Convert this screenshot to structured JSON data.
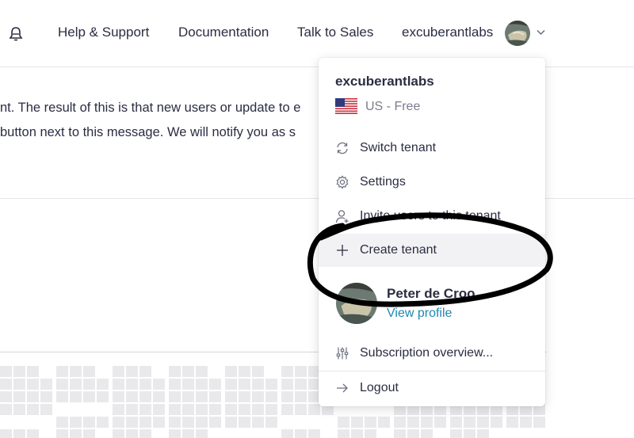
{
  "header": {
    "nav": {
      "help": "Help & Support",
      "docs": "Documentation",
      "sales": "Talk to Sales"
    },
    "user_name": "excuberantlabs"
  },
  "banner": {
    "line1": "nt. The result of this is that new users or update to e",
    "line2": "button next to this message. We will notify you as s"
  },
  "menu": {
    "tenant_name": "excuberantlabs",
    "region": "US - Free",
    "items": {
      "switch": "Switch tenant",
      "settings": "Settings",
      "invite": "Invite users to this tenant",
      "create": "Create tenant",
      "subscription": "Subscription overview...",
      "logout": "Logout"
    },
    "profile": {
      "name": "Peter de Croo",
      "link": "View profile"
    }
  },
  "icons": {
    "bell": "bell-icon",
    "chevron": "chevron-down-icon",
    "flag": "us-flag-icon",
    "switch": "refresh-icon",
    "settings": "gear-icon",
    "invite": "user-plus-icon",
    "create": "plus-icon",
    "subscription": "sliders-icon",
    "logout": "arrow-right-icon"
  },
  "colors": {
    "text": "#2b2d42",
    "muted": "#7a7c8c",
    "link": "#1e88b4",
    "hover": "#f2f2f4",
    "annotation": "#000000"
  }
}
